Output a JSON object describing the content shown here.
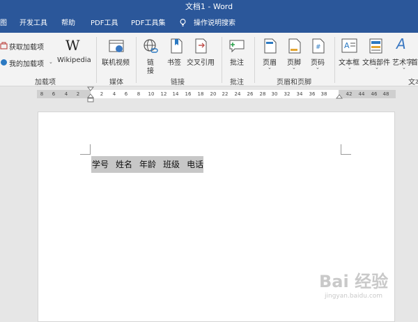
{
  "titlebar": {
    "title": "文档1  -  Word"
  },
  "tabs": [
    "图",
    "开发工具",
    "帮助",
    "PDF工具",
    "PDF工具集",
    "操作说明搜索"
  ],
  "ribbon": {
    "addins": {
      "get_addins": "获取加载项",
      "my_addins": "我的加载项",
      "wikipedia": "Wikipedia",
      "group": "加载项"
    },
    "media": {
      "online_video": "联机视频",
      "group": "媒体"
    },
    "links": {
      "link_l1": "链",
      "link_l2": "接",
      "bookmark": "书签",
      "crossref": "交叉引用",
      "group": "链接"
    },
    "comments": {
      "comment": "批注",
      "group": "批注"
    },
    "header_footer": {
      "header": "页眉",
      "footer": "页脚",
      "page_number": "页码",
      "group": "页眉和页脚"
    },
    "text": {
      "textbox": "文本框",
      "quickparts": "文档部件",
      "wordart": "艺术字",
      "dropcap": "首",
      "group": "文本"
    }
  },
  "ruler": {
    "ticks": [
      "8",
      "6",
      "4",
      "2",
      "2",
      "4",
      "6",
      "8",
      "10",
      "12",
      "14",
      "16",
      "18",
      "20",
      "22",
      "24",
      "26",
      "28",
      "30",
      "32",
      "34",
      "36",
      "38",
      "42",
      "44",
      "46",
      "48"
    ]
  },
  "document": {
    "headers": [
      "学号",
      "姓名",
      "年龄",
      "班级",
      "电话"
    ]
  },
  "watermark": {
    "brand": "Bai 经验",
    "url": "jingyan.baidu.com"
  },
  "colors": {
    "ribbon_blue": "#2b579a",
    "ribbon_bg": "#f3f3f3",
    "selection": "#c7c7c7"
  }
}
